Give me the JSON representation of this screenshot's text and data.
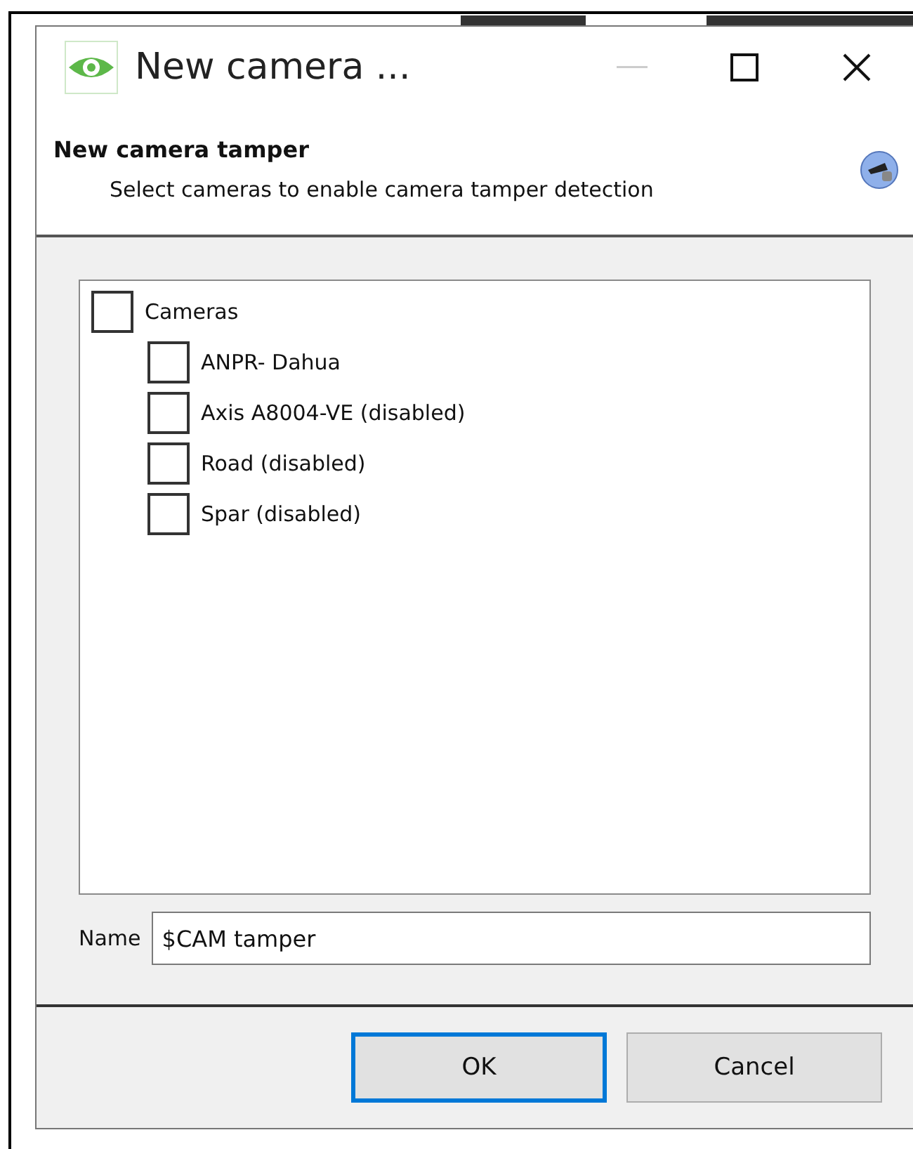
{
  "window": {
    "title": "New camera ..."
  },
  "header": {
    "title": "New camera tamper",
    "subtitle": "Select cameras to enable camera tamper detection"
  },
  "tree": [
    {
      "label": "Cameras",
      "checked": false,
      "children": [
        {
          "label": "ANPR- Dahua",
          "checked": false
        },
        {
          "label": "Axis A8004-VE (disabled)",
          "checked": false
        },
        {
          "label": "Road (disabled)",
          "checked": false
        },
        {
          "label": "Spar (disabled)",
          "checked": false
        }
      ]
    }
  ],
  "name_field": {
    "label": "Name",
    "value": "$CAM tamper"
  },
  "buttons": [
    {
      "label": "OK",
      "default": true
    },
    {
      "label": "Cancel",
      "default": false
    }
  ]
}
